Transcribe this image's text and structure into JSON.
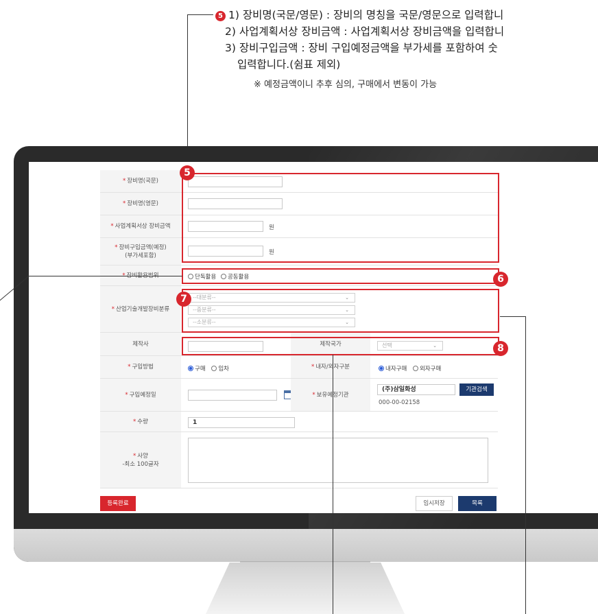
{
  "annotation": {
    "badge": "5",
    "line1": "1) 장비명(국문/영문) : 장비의 명칭을 국문/영문으로 입력합니",
    "line2": "2) 사업계획서상 장비금액 : 사업계획서상 장비금액을 입력합니",
    "line3": "3) 장비구입금액 : 장비 구입예정금액을 부가세를 포함하여 숫",
    "line4": "입력합니다.(쉼표 제외)",
    "note": "※ 예정금액이니 추후 심의, 구매에서 변동이 가능"
  },
  "badges": {
    "b5": "5",
    "b6": "6",
    "b7": "7",
    "b8": "8"
  },
  "form": {
    "name_ko_label": "장비명(국문)",
    "name_en_label": "장비명(영문)",
    "plan_amount_label": "사업계획서상 장비금액",
    "plan_amount_unit": "원",
    "purchase_amount_label": "장비구입금액(예정)",
    "purchase_amount_sub": "(부가세포함)",
    "purchase_amount_unit": "원",
    "usage_label": "장비활용범위",
    "usage_option1": "단독활용",
    "usage_option2": "공동활용",
    "category_label": "산업기술개발장비분류",
    "category_major": "--대분류--",
    "category_middle": "--중분류--",
    "category_minor": "--소분류--",
    "maker_label": "제작사",
    "maker_country_label": "제작국가",
    "maker_country_value": "선택",
    "purchase_method_label": "구입방법",
    "purchase_method_opt1": "구매",
    "purchase_method_opt2": "임차",
    "domestic_label": "내자/외자구분",
    "domestic_opt1": "내자구매",
    "domestic_opt2": "외자구매",
    "purchase_date_label": "구입예정일",
    "holding_org_label": "보유예정기관",
    "holding_org_value": "(주)삼일화성",
    "holding_org_code": "000-00-02158",
    "org_search_button": "기관검색",
    "quantity_label": "수량",
    "quantity_value": "1",
    "spec_label": "사양",
    "spec_sub": "-최소 100글자",
    "register_button": "등록완료",
    "temp_save_button": "임시저장",
    "list_button": "목록"
  },
  "colors": {
    "accent": "#d8262d",
    "navy": "#1c3a6e",
    "radio": "#2a5bd7"
  }
}
